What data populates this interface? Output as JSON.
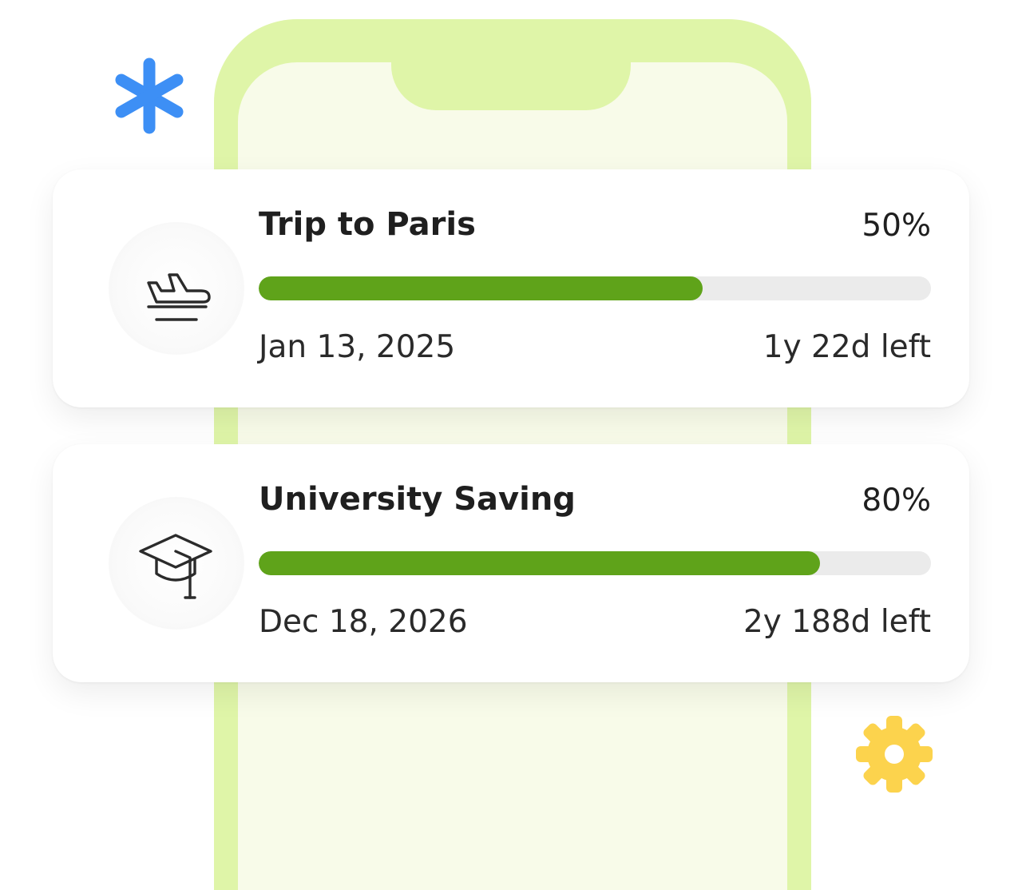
{
  "decorations": {
    "top_left": {
      "icon": "asterisk-icon",
      "color": "#3d8ff5"
    },
    "bottom_right": {
      "icon": "gear-icon",
      "color": "#fcd34d"
    }
  },
  "phone": {
    "frame_color": "#dff5a8",
    "screen_color": "#f8fbe9"
  },
  "accent_color": "#5fa31a",
  "goals": [
    {
      "icon": "airplane-takeoff-icon",
      "title": "Trip to Paris",
      "percent_label": "50%",
      "progress_fill_fraction": 0.66,
      "date": "Jan 13, 2025",
      "remaining": "1y 22d left"
    },
    {
      "icon": "graduation-cap-icon",
      "title": "University Saving",
      "percent_label": "80%",
      "progress_fill_fraction": 0.835,
      "date": "Dec 18, 2026",
      "remaining": "2y 188d left"
    }
  ]
}
